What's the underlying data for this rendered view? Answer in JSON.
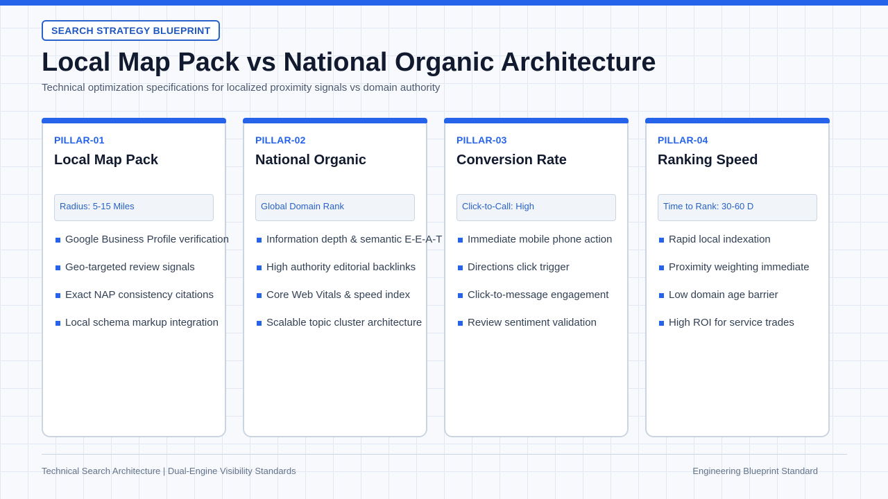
{
  "header": {
    "badge": "SEARCH STRATEGY BLUEPRINT",
    "title": "Local Map Pack vs National Organic Architecture",
    "subtitle": "Technical optimization specifications for localized proximity signals vs domain authority"
  },
  "colors": {
    "accent": "#2563eb",
    "heading": "#111a2e",
    "body_text": "#334155",
    "muted_text": "#64748b",
    "card_border": "#cbd5e1",
    "metric_bg": "#f1f5f9"
  },
  "pillars": [
    {
      "id": "PILLAR-01",
      "title": "Local Map Pack",
      "metric": "Radius: 5-15 Miles",
      "features": [
        "Google Business Profile verification",
        "Geo-targeted review signals",
        "Exact NAP consistency citations",
        "Local schema markup integration"
      ]
    },
    {
      "id": "PILLAR-02",
      "title": "National Organic",
      "metric": "Global Domain Rank",
      "features": [
        "Information depth & semantic E-E-A-T",
        "High authority editorial backlinks",
        "Core Web Vitals & speed index",
        "Scalable topic cluster architecture"
      ]
    },
    {
      "id": "PILLAR-03",
      "title": "Conversion Rate",
      "metric": "Click-to-Call: High",
      "features": [
        "Immediate mobile phone action",
        "Directions click trigger",
        "Click-to-message engagement",
        "Review sentiment validation"
      ]
    },
    {
      "id": "PILLAR-04",
      "title": "Ranking Speed",
      "metric": "Time to Rank: 30-60 D",
      "features": [
        "Rapid local indexation",
        "Proximity weighting immediate",
        "Low domain age barrier",
        "High ROI for service trades"
      ]
    }
  ],
  "footer": {
    "left": "Technical Search Architecture | Dual-Engine Visibility Standards",
    "right": "Engineering Blueprint Standard"
  }
}
